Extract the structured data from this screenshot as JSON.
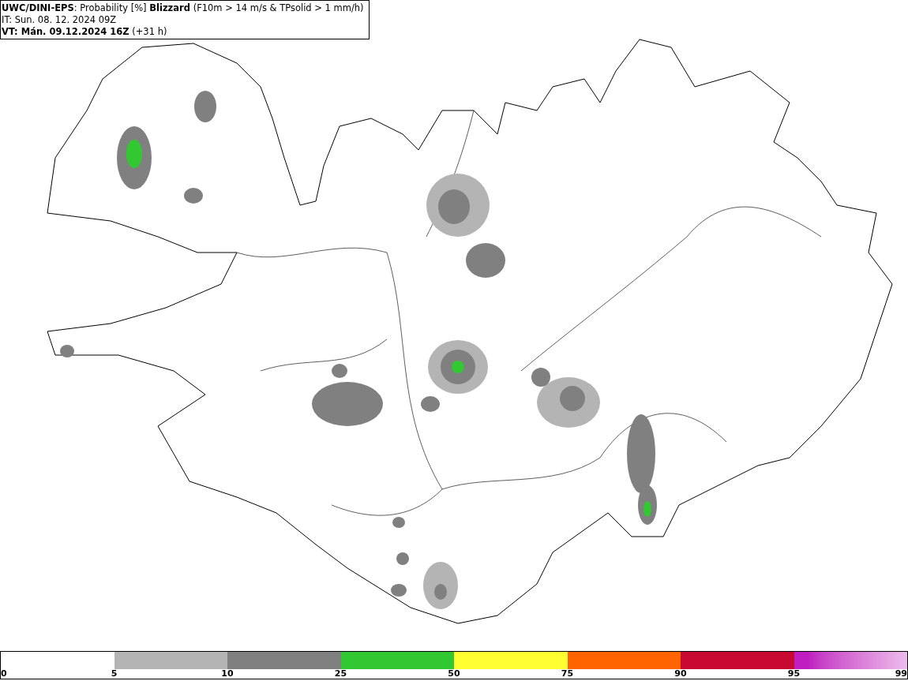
{
  "header": {
    "lines": [
      "**UWC/DINI-EPS**: Probability [%] **Blizzard** (F10m > 14 m/s & TPsolid > 1 mm/h)",
      "IT: Sun. 08. 12. 2024 09Z",
      "**VT: Mán. 09.12.2024 16Z** (+31 h)"
    ]
  },
  "legend": {
    "bins": [
      {
        "color": "#b4b4b4",
        "gradient": false
      },
      {
        "color": "#808080",
        "gradient": false
      },
      {
        "color": "#32c832",
        "gradient": false
      },
      {
        "color": "#ffff32",
        "gradient": false
      },
      {
        "color": "#ff6400",
        "gradient": false
      },
      {
        "color": "#c80a32",
        "gradient": false
      },
      {
        "color": "#c01ec0",
        "gradient": true
      }
    ],
    "ticks": [
      "0",
      "5",
      "10",
      "25",
      "50",
      "75",
      "90",
      "95",
      "99"
    ]
  }
}
